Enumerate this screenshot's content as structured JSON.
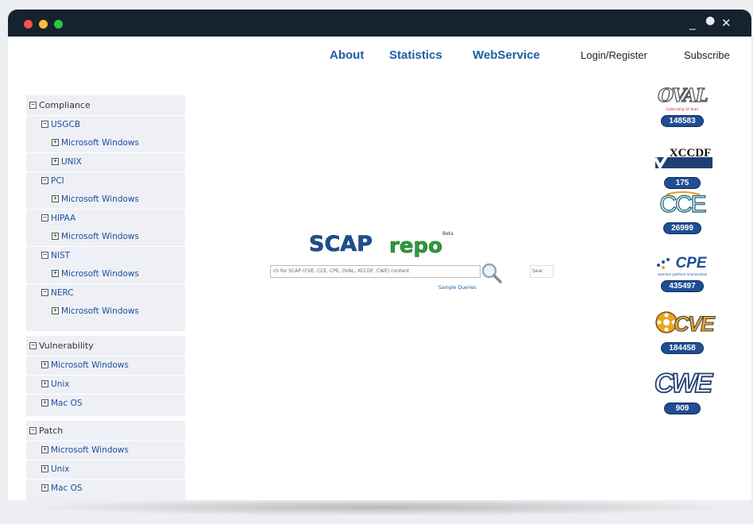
{
  "window": {
    "controls": [
      "_",
      "●",
      "✕"
    ]
  },
  "nav": {
    "about": "About",
    "statistics": "Statistics",
    "webservice": "WebService"
  },
  "auth": {
    "login": "Login/Register",
    "subscribe": "Subscribe"
  },
  "sidebar": {
    "compliance": {
      "label": "Compliance",
      "usgcb": {
        "label": "USGCB",
        "windows": "Microsoft Windows",
        "unix": "UNIX"
      },
      "pci": {
        "label": "PCI",
        "windows": "Microsoft Windows"
      },
      "hipaa": {
        "label": "HIPAA",
        "windows": "Microsoft Windows"
      },
      "nist": {
        "label": "NIST",
        "windows": "Microsoft Windows"
      },
      "nerc": {
        "label": "NERC",
        "windows": "Microsoft Windows"
      }
    },
    "vulnerability": {
      "label": "Vulnerability",
      "windows": "Microsoft Windows",
      "unix": "Unix",
      "mac": "Mac OS"
    },
    "patch": {
      "label": "Patch",
      "windows": "Microsoft Windows",
      "unix": "Unix",
      "mac": "Mac OS"
    }
  },
  "logo": {
    "part1": "SCAP",
    "part2": "repo",
    "beta": "Beta"
  },
  "search": {
    "placeholder": "ch for SCAP (CVE, CCE, CPE, OVAL, XCCDF, CWE) content",
    "secondary_placeholder": "Sear",
    "sample_queries": "Sample Queries"
  },
  "standards": {
    "oval": {
      "name": "OVAL",
      "tagline": "Celebrating 10 Years",
      "count": "148583"
    },
    "xccdf": {
      "name": "XCCDF",
      "count": "175"
    },
    "cce": {
      "name": "CCE",
      "count": "26999"
    },
    "cpe": {
      "name": "CPE",
      "tagline": "common platform enumeration",
      "count": "435497"
    },
    "cve": {
      "name": "CVE",
      "count": "184458"
    },
    "cwe": {
      "name": "CWE",
      "count": "909"
    }
  },
  "colors": {
    "titlebar": "#16222e",
    "nav": "#1b5fa0",
    "sidebar_bg": "#eef0f6",
    "badge": "#1f4e93",
    "logo_blue": "#1d4f91",
    "logo_green": "#2b9b3a"
  }
}
